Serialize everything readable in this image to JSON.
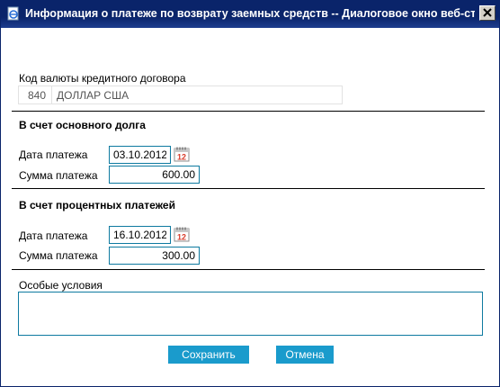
{
  "window": {
    "title": "Информация о платеже по возврату заемных средств -- Диалоговое окно веб-стра..."
  },
  "currency": {
    "label": "Код валюты кредитного договора",
    "code": "840",
    "name": "ДОЛЛАР США"
  },
  "principal": {
    "heading": "В счет основного долга",
    "date_label": "Дата платежа",
    "date_value": "03.10.2012",
    "amount_label": "Сумма платежа",
    "amount_value": "600.00"
  },
  "interest": {
    "heading": "В счет процентных платежей",
    "date_label": "Дата платежа",
    "date_value": "16.10.2012",
    "amount_label": "Сумма платежа",
    "amount_value": "300.00"
  },
  "conditions": {
    "label": "Особые условия",
    "value": ""
  },
  "calendar": {
    "day": "12"
  },
  "buttons": {
    "save": "Сохранить",
    "cancel": "Отмена"
  },
  "colors": {
    "titlebar": "#0a246a",
    "accent": "#1a9bcc",
    "field_border": "#0e7aa0"
  },
  "icons": {
    "title": "ie-page-icon",
    "close": "close-icon",
    "calendar": "calendar-icon"
  }
}
